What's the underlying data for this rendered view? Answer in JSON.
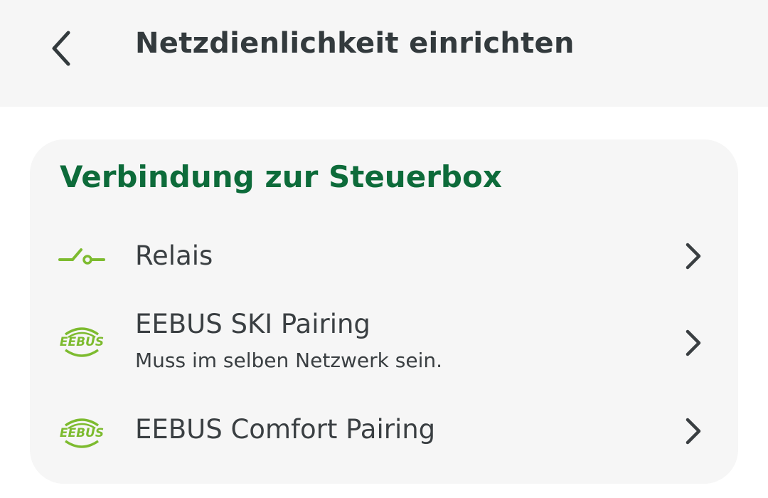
{
  "header": {
    "title": "Netzdienlichkeit einrichten",
    "back_icon": "chevron-left-icon"
  },
  "section": {
    "title": "Verbindung zur Steuerbox"
  },
  "items": [
    {
      "label": "Relais",
      "icon": "relay-switch-icon",
      "sublabel": ""
    },
    {
      "label": "EEBUS SKI Pairing",
      "icon": "eebus-logo-icon",
      "sublabel": "Muss im selben Netzwerk sein."
    },
    {
      "label": "EEBUS Comfort Pairing",
      "icon": "eebus-logo-icon",
      "sublabel": ""
    }
  ],
  "logo_text": "EEBUS",
  "colors": {
    "header_bg": "#f6f6f6",
    "card_bg": "#f6f6f6",
    "section_title": "#0d6b3a",
    "icon_green": "#7dbb2f",
    "text": "#3a3f42"
  }
}
